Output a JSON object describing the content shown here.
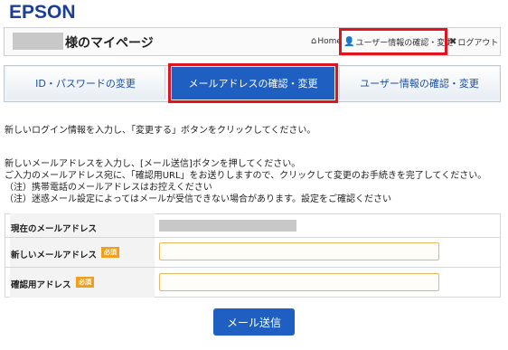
{
  "brand": {
    "logo": "EPSON"
  },
  "header": {
    "title": "様のマイページ",
    "nav": {
      "home": "Home",
      "user_info": "ユーザー情報の確認・変更",
      "logout": "ログアウト"
    }
  },
  "tabs": [
    {
      "label": "ID・パスワードの変更",
      "active": false
    },
    {
      "label": "メールアドレスの確認・変更",
      "active": true
    },
    {
      "label": "ユーザー情報の確認・変更",
      "active": false
    }
  ],
  "intro": {
    "line1": "新しいログイン情報を入力し、「変更する」ボタンをクリックしてください。"
  },
  "instructions": [
    "新しいメールアドレスを入力し、[メール送信]ボタンを押してください。",
    "ご入力のメールアドレス宛に、「確認用URL」をお送りしますので、クリックして変更のお手続きを完了してください。",
    "（注）携帯電話のメールアドレスはお控えください",
    "（注）迷惑メール設定によってはメールが受信できない場合があります。設定をご確認ください"
  ],
  "form": {
    "current_email_label": "現在のメールアドレス",
    "new_email_label": "新しいメールアドレス",
    "confirm_label": "確認用アドレス",
    "required_badge": "必須",
    "new_email_value": "",
    "confirm_value": ""
  },
  "submit_label": "メール送信",
  "colors": {
    "accent": "#1e5fc1",
    "highlight": "#e0141e",
    "required": "#f0a020"
  },
  "icons": {
    "home": "home-icon",
    "user": "user-icon",
    "logout": "close-icon"
  }
}
